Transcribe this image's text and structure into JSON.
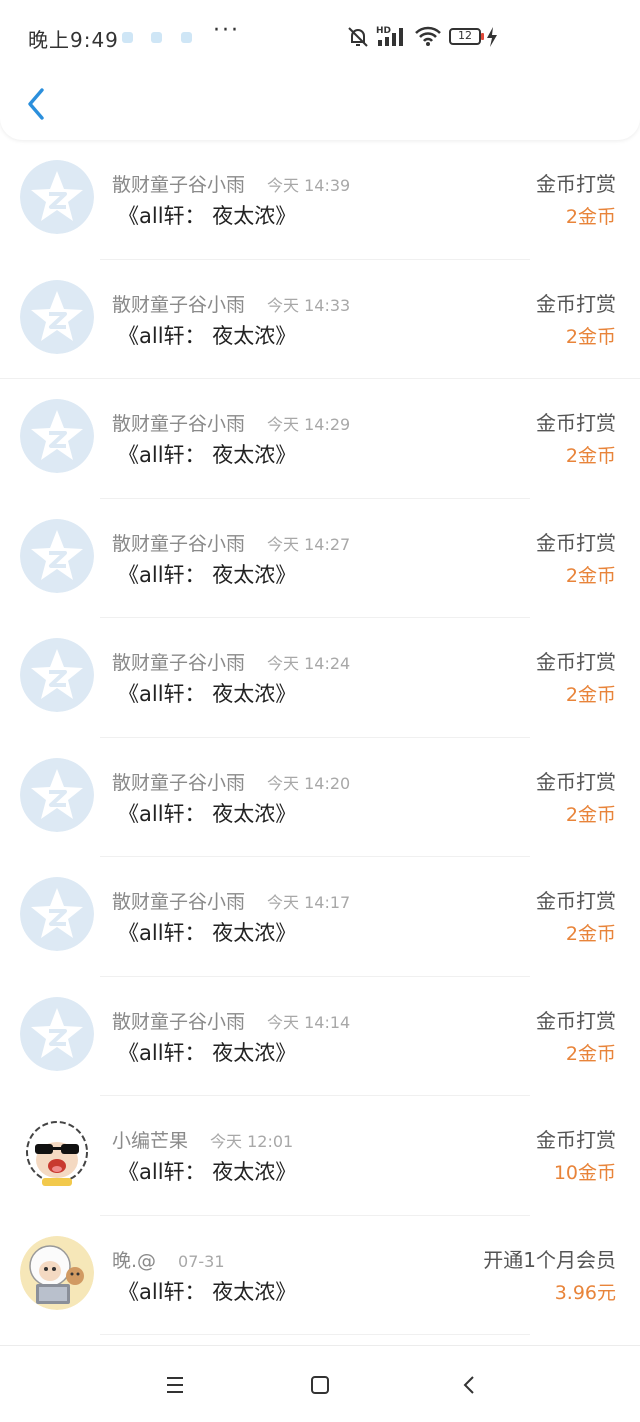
{
  "status_bar": {
    "time": "晚上9:49",
    "more": "···",
    "battery": "12"
  },
  "colors": {
    "accent": "#2b8fdc",
    "amount": "#e8843a",
    "avatar_bg": "#dde9f4"
  },
  "records": [
    {
      "sender": "散财童子谷小雨",
      "time": "今天 14:39",
      "title": "《all轩： 夜太浓》",
      "type": "金币打赏",
      "amount": "2金币",
      "avatar": "qzone-star-icon"
    },
    {
      "sender": "散财童子谷小雨",
      "time": "今天 14:33",
      "title": "《all轩： 夜太浓》",
      "type": "金币打赏",
      "amount": "2金币",
      "avatar": "qzone-star-icon"
    },
    {
      "sender": "散财童子谷小雨",
      "time": "今天 14:29",
      "title": "《all轩： 夜太浓》",
      "type": "金币打赏",
      "amount": "2金币",
      "avatar": "qzone-star-icon"
    },
    {
      "sender": "散财童子谷小雨",
      "time": "今天 14:27",
      "title": "《all轩： 夜太浓》",
      "type": "金币打赏",
      "amount": "2金币",
      "avatar": "qzone-star-icon"
    },
    {
      "sender": "散财童子谷小雨",
      "time": "今天 14:24",
      "title": "《all轩： 夜太浓》",
      "type": "金币打赏",
      "amount": "2金币",
      "avatar": "qzone-star-icon"
    },
    {
      "sender": "散财童子谷小雨",
      "time": "今天 14:20",
      "title": "《all轩： 夜太浓》",
      "type": "金币打赏",
      "amount": "2金币",
      "avatar": "qzone-star-icon"
    },
    {
      "sender": "散财童子谷小雨",
      "time": "今天 14:17",
      "title": "《all轩： 夜太浓》",
      "type": "金币打赏",
      "amount": "2金币",
      "avatar": "qzone-star-icon"
    },
    {
      "sender": "散财童子谷小雨",
      "time": "今天 14:14",
      "title": "《all轩： 夜太浓》",
      "type": "金币打赏",
      "amount": "2金币",
      "avatar": "qzone-star-icon"
    },
    {
      "sender": "小编芒果",
      "time": "今天 12:01",
      "title": "《all轩： 夜太浓》",
      "type": "金币打赏",
      "amount": "10金币",
      "avatar": "sheep-sunglasses-avatar"
    },
    {
      "sender": "晚.@",
      "time": "07-31",
      "title": "《all轩： 夜太浓》",
      "type": "开通1个月会员",
      "amount": "3.96元",
      "avatar": "sheep-laptop-avatar"
    }
  ]
}
